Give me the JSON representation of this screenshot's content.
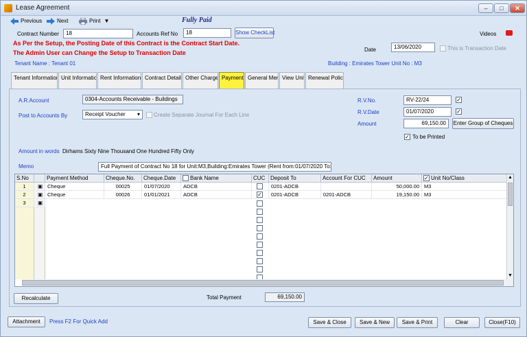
{
  "window": {
    "title": "Lease Agreement"
  },
  "toolbar": {
    "previous": "Previous",
    "next": "Next",
    "print": "Print",
    "status": "Fully Paid"
  },
  "header": {
    "contract_number_label": "Contract Number",
    "contract_number": "18",
    "accounts_ref_label": "Accounts Ref No",
    "accounts_ref": "18",
    "show_checklist": "Show CheckList",
    "videos": "Videos",
    "warning1": "As Per the Setup, the Posting Date of this Contract is the Contract Start Date.",
    "warning2": "The Admin User can Change the Setup to Transaction Date",
    "date_label": "Date",
    "date": "13/06/2020",
    "is_transaction_date": "This is Transaction Date",
    "tenant": "Tenant Name : Tenant 01",
    "building": "Building : Emirates Tower  Unit No : M3"
  },
  "tabs": [
    {
      "label": "Tenant Information"
    },
    {
      "label": "Unit Information"
    },
    {
      "label": "Rent Information"
    },
    {
      "label": "Contract Details"
    },
    {
      "label": "Other Charges"
    },
    {
      "label": "Payment"
    },
    {
      "label": "General Memo"
    },
    {
      "label": "View Unit"
    },
    {
      "label": "Renewal Policy"
    }
  ],
  "payment": {
    "ar_account_label": "A.R.Account",
    "ar_account": "0304-Accounts Receivable - Buildings",
    "post_by_label": "Post to Accounts By",
    "post_by": "Receipt Voucher",
    "separate_journal": "Create Separate Journal For Each Line",
    "rv_no_label": "R.V.No.",
    "rv_no": "RV-22/24",
    "rv_date_label": "R.V.Date",
    "rv_date": "01/07/2020",
    "amount_label": "Amount",
    "amount": "69,150.00",
    "enter_group": "Enter Group of Cheques",
    "to_be_printed": "To be Printed",
    "amount_words_label": "Amount in words",
    "amount_words": "Dirhams  Sixty Nine Thousand  One Hundred  Fifty Only",
    "memo_label": "Memo",
    "memo": "Full Payment of Contract No 18 for Unit:M3,Building:Emirates Tower (Rent from:01/07/2020 To:30/06/2021)"
  },
  "grid": {
    "headers": {
      "sno": "S.No",
      "method": "Payment Method",
      "cheque_no": "Cheque.No.",
      "cheque_date": "Cheque.Date",
      "bank": "Bank Name",
      "cuc": "CUC",
      "deposit": "Deposit To",
      "account_cuc": "Account For CUC",
      "amount": "Amount",
      "unit": "Unit No/Class"
    },
    "rows": [
      {
        "sno": "1",
        "method": "Cheque",
        "cheque_no": "00025",
        "cheque_date": "01/07/2020",
        "bank": "ADCB",
        "cuc": "",
        "deposit": "0201-ADCB",
        "account_cuc": "",
        "amount": "50,000.00",
        "unit": "M3"
      },
      {
        "sno": "2",
        "method": "Cheque",
        "cheque_no": "00026",
        "cheque_date": "01/01/2021",
        "bank": "ADCB",
        "cuc": "✓",
        "deposit": "0201-ADCB",
        "account_cuc": "0201-ADCB",
        "amount": "19,150.00",
        "unit": "M3"
      },
      {
        "sno": "3",
        "method": "",
        "cheque_no": "",
        "cheque_date": "",
        "bank": "",
        "cuc": "",
        "deposit": "",
        "account_cuc": "",
        "amount": "",
        "unit": ""
      }
    ]
  },
  "footer": {
    "recalculate": "Recalculate",
    "total_label": "Total Payment",
    "total": "69,150.00",
    "attachment": "Attachment",
    "hint": "Press F2 For Quick Add",
    "save_close": "Save & Close",
    "save_new": "Save & New",
    "save_print": "Save & Print",
    "clear": "Clear",
    "close": "Close(F10)"
  }
}
